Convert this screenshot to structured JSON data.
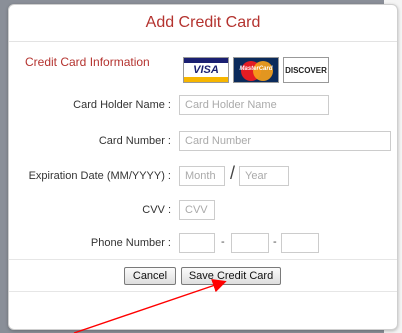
{
  "dialog": {
    "title": "Add Credit Card",
    "section_title": "Credit Card Information",
    "card_logos": [
      "VISA",
      "MasterCard",
      "DISCOVER"
    ]
  },
  "form": {
    "card_holder": {
      "label": "Card Holder Name :",
      "placeholder": "Card Holder Name",
      "value": ""
    },
    "card_number": {
      "label": "Card Number :",
      "placeholder": "Card Number",
      "value": ""
    },
    "expiration": {
      "label": "Expiration Date (MM/YYYY) :",
      "month_placeholder": "Month",
      "separator": "/",
      "year_placeholder": "Year"
    },
    "cvv": {
      "label": "CVV :",
      "placeholder": "CVV"
    },
    "phone": {
      "label": "Phone Number :",
      "separator": "-"
    }
  },
  "buttons": {
    "cancel": "Cancel",
    "save": "Save Credit Card"
  },
  "annotation": {
    "arrow_color": "#ff0000"
  }
}
